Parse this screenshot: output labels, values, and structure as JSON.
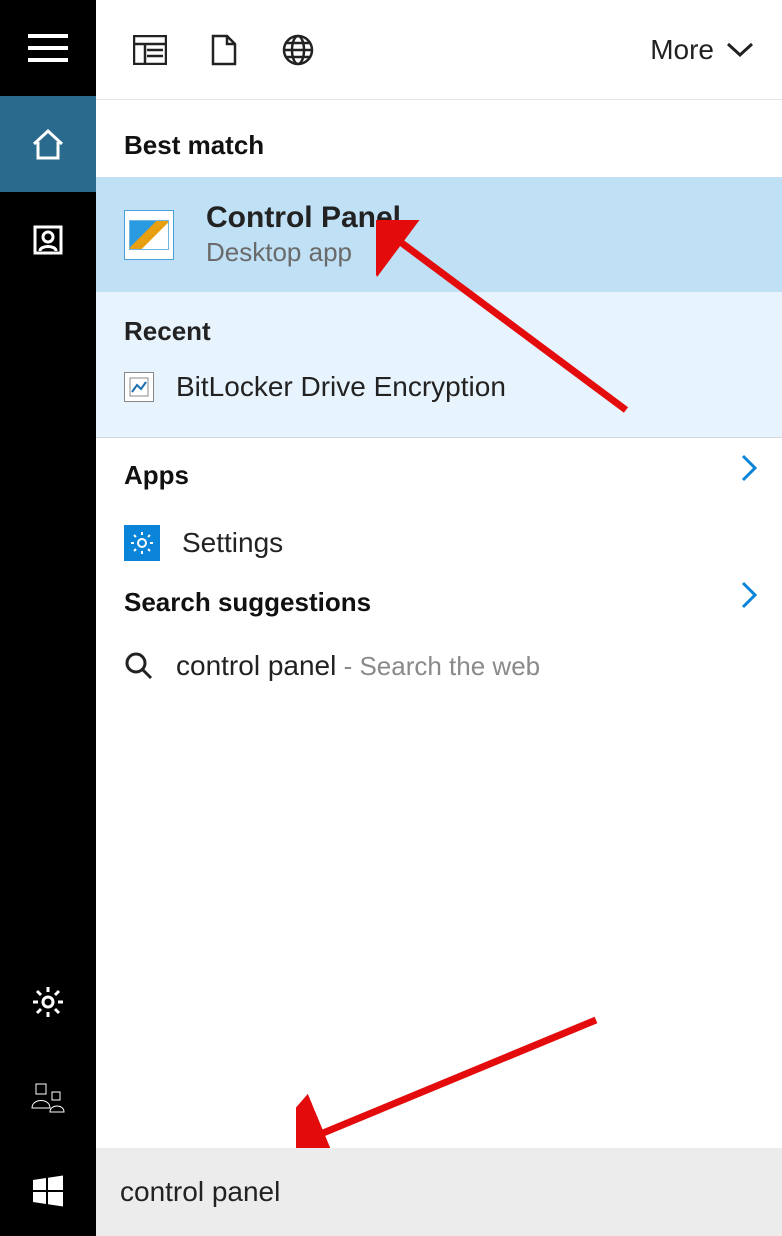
{
  "more_label": "More",
  "best_match": {
    "header": "Best match",
    "title": "Control Panel",
    "subtitle": "Desktop app"
  },
  "recent": {
    "header": "Recent",
    "items": [
      {
        "label": "BitLocker Drive Encryption"
      }
    ]
  },
  "apps": {
    "header": "Apps",
    "items": [
      {
        "label": "Settings"
      }
    ]
  },
  "suggestions": {
    "header": "Search suggestions",
    "items": [
      {
        "label": "control panel",
        "suffix": " - Search the web"
      }
    ]
  },
  "search_value": "control panel"
}
